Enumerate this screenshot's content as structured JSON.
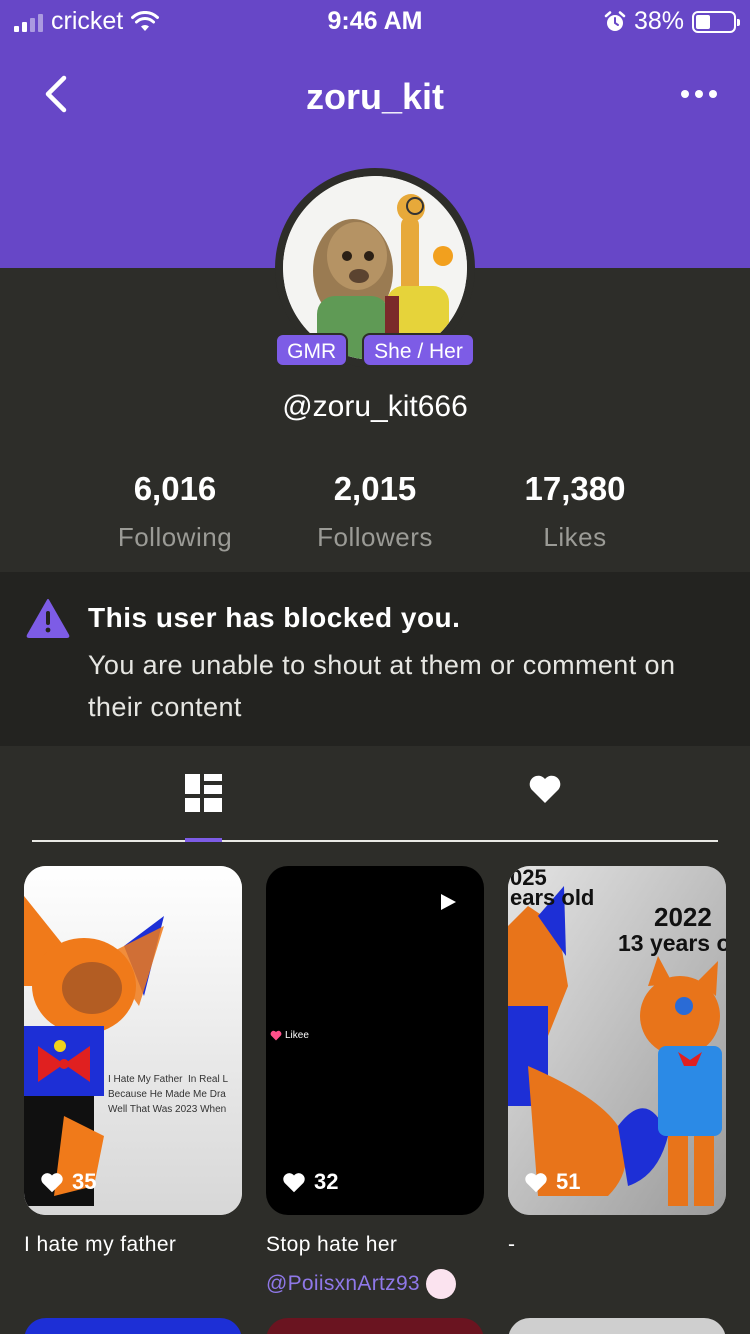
{
  "status_bar": {
    "carrier": "cricket",
    "time": "9:46 AM",
    "battery": "38%",
    "battery_level": 0.38
  },
  "nav": {
    "title": "zoru_kit",
    "back_icon": "chevron-left-icon",
    "more_icon": "more-horizontal-icon"
  },
  "profile": {
    "badges": [
      "GMR",
      "She / Her"
    ],
    "handle": "@zoru_kit666"
  },
  "stats": [
    {
      "value": "6,016",
      "label": "Following"
    },
    {
      "value": "2,015",
      "label": "Followers"
    },
    {
      "value": "17,380",
      "label": "Likes"
    }
  ],
  "blocked": {
    "title": "This user has blocked you.",
    "message": "You are unable to shout at them or comment on their content"
  },
  "tabs": [
    {
      "icon": "grid-icon",
      "selected": true
    },
    {
      "icon": "heart-icon",
      "selected": false
    }
  ],
  "posts": [
    {
      "title": "I hate my father",
      "likes": "35",
      "caption": "I Hate My Father  In Real L\nBecause He Made Me Dra\nWell That Was 2023 When"
    },
    {
      "title": "Stop hate her",
      "likes": "32",
      "author": "@PoiisxnArtz93",
      "watermark": "Likee"
    },
    {
      "title": "-",
      "likes": "51",
      "overlay_left": "025\nears old",
      "overlay_right_year": "2022",
      "overlay_right_age": "13 years o"
    }
  ],
  "colors": {
    "brand": "#6747c7",
    "accent": "#7d5ce6",
    "background": "#2d2d29"
  }
}
